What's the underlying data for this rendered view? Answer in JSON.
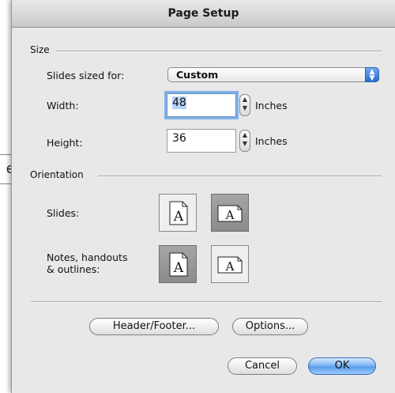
{
  "window": {
    "title": "Page Setup"
  },
  "background": {
    "fragment_text": "e"
  },
  "size": {
    "label": "Size",
    "slides_sized_for_label": "Slides sized for:",
    "slides_sized_for_value": "Custom",
    "width_label": "Width:",
    "width_value": "48",
    "width_unit": "Inches",
    "height_label": "Height:",
    "height_value": "36",
    "height_unit": "Inches"
  },
  "orientation": {
    "label": "Orientation",
    "slides_label": "Slides:",
    "notes_label_line1": "Notes, handouts",
    "notes_label_line2": "& outlines:",
    "glyph": "A",
    "slides_selected": "landscape",
    "notes_selected": "portrait"
  },
  "buttons": {
    "header_footer": "Header/Footer...",
    "options": "Options...",
    "cancel": "Cancel",
    "ok": "OK"
  },
  "colors": {
    "accent": "#5a9ce9",
    "focus_ring": "#7fb1ea"
  }
}
